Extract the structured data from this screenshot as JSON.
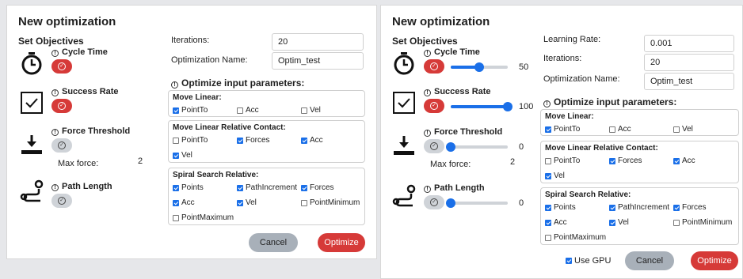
{
  "dialog_title": "New optimization",
  "set_objectives": "Set Objectives",
  "objectives": {
    "cycle_time": "Cycle Time",
    "success_rate": "Success Rate",
    "force_threshold": "Force Threshold",
    "path_length": "Path Length"
  },
  "max_force_label": "Max force:",
  "max_force_value": "2",
  "slider_values": {
    "cycle_time": "50",
    "success_rate": "100",
    "force_threshold": "0",
    "path_length": "0"
  },
  "slider_fraction": {
    "cycle_time": 0.5,
    "success_rate": 1.0,
    "force_threshold": 0.0,
    "path_length": 0.0
  },
  "fields": {
    "learning_rate_label": "Learning Rate:",
    "learning_rate_value": "0.001",
    "iterations_label": "Iterations:",
    "iterations_value": "20",
    "name_label": "Optimization Name:",
    "name_value": "Optim_test"
  },
  "optimize_title": "Optimize input parameters:",
  "groups": {
    "move_linear": {
      "title": "Move Linear:",
      "items": [
        "PointTo",
        "Acc",
        "Vel"
      ]
    },
    "mlrc": {
      "title": "Move Linear Relative Contact:",
      "items": [
        "PointTo",
        "Forces",
        "Acc",
        "Vel"
      ]
    },
    "spiral": {
      "title": "Spiral Search Relative:",
      "items": [
        "Points",
        "PathIncrement",
        "Forces",
        "Acc",
        "Vel",
        "PointMinimum",
        "PointMaximum"
      ]
    }
  },
  "buttons": {
    "cancel": "Cancel",
    "optimize": "Optimize",
    "use_gpu": "Use GPU"
  },
  "colors": {
    "accent_red": "#d63a38",
    "accent_blue": "#1a6fe8",
    "toggle_off": "#cfd3d8"
  },
  "icons": {
    "cycle_time": "stopwatch-icon",
    "success_rate": "checkbox-icon",
    "force_threshold": "press-down-icon",
    "path_length": "route-icon",
    "info": "info-icon",
    "check": "check-circle-icon"
  }
}
